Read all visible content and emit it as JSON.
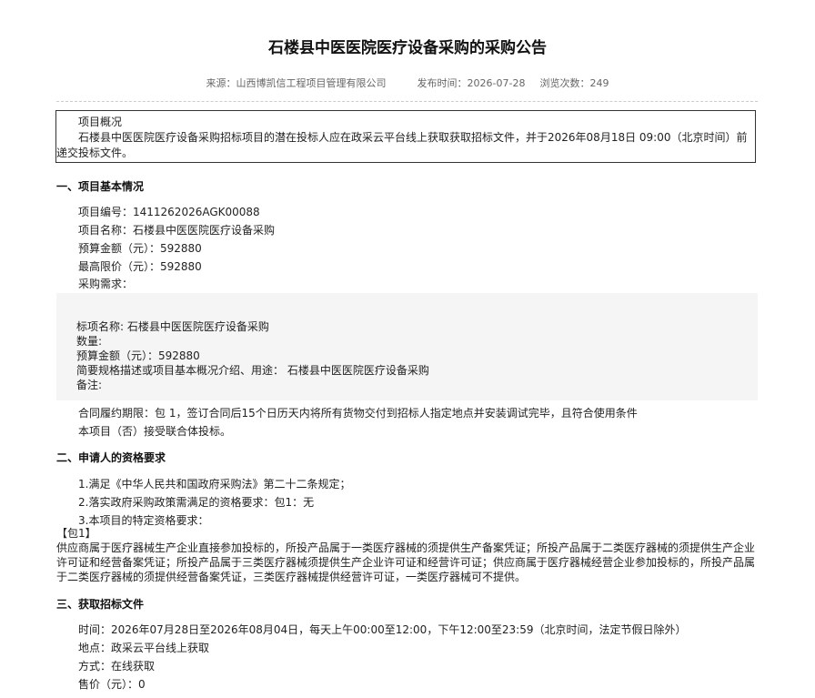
{
  "header": {
    "title": "石楼县中医医院医疗设备采购的采购公告",
    "source": "来源：山西博凯信工程项目管理有限公司",
    "publish_time": "发布时间：2026-07-28",
    "views": "浏览次数：249"
  },
  "overview": {
    "title": "项目概况",
    "text": "石楼县中医医院医疗设备采购招标项目的潜在投标人应在政采云平台线上获取获取招标文件，并于2026年08月18日 09:00（北京时间）前递交投标文件。"
  },
  "section1": {
    "heading": "一、项目基本情况",
    "project_no": "项目编号：1411262026AGK00088",
    "project_name": "项目名称：石楼县中医医院医疗设备采购",
    "budget": "预算金额（元）：592880",
    "max_price": "最高限价（元）：592880",
    "demand": "采购需求：",
    "lot": {
      "name": "标项名称: 石楼县中医医院医疗设备采购",
      "qty": "数量:",
      "budget": "预算金额（元）：592880",
      "desc": "简要规格描述或项目基本概况介绍、用途：  石楼县中医医院医疗设备采购",
      "remark": "备注:"
    },
    "contract_period": "合同履约期限：包 1，签订合同后15个日历天内将所有货物交付到招标人指定地点并安装调试完毕，且符合使用条件",
    "consortium": "本项目（否）接受联合体投标。"
  },
  "section2": {
    "heading": "二、申请人的资格要求",
    "req1": "1.满足《中华人民共和国政府采购法》第二十二条规定；",
    "req2": "2.落实政府采购政策需满足的资格要求：包1：无",
    "req3": "3.本项目的特定资格要求：",
    "pkg": "【包1】",
    "pkg_text": "供应商属于医疗器械生产企业直接参加投标的，所投产品属于一类医疗器械的须提供生产备案凭证；所投产品属于二类医疗器械的须提供生产企业许可证和经营备案凭证；所投产品属于三类医疗器械须提供生产企业许可证和经营许可证；供应商属于医疗器械经营企业参加投标的，所投产品属于二类医疗器械的须提供经营备案凭证，三类医疗器械提供经营许可证，一类医疗器械可不提供。"
  },
  "section3": {
    "heading": "三、获取招标文件",
    "time": "时间：2026年07月28日至2026年08月04日，每天上午00:00至12:00，下午12:00至23:59（北京时间，法定节假日除外）",
    "place": "地点：政采云平台线上获取",
    "method": "方式：在线获取",
    "price": "售价（元）：0"
  }
}
